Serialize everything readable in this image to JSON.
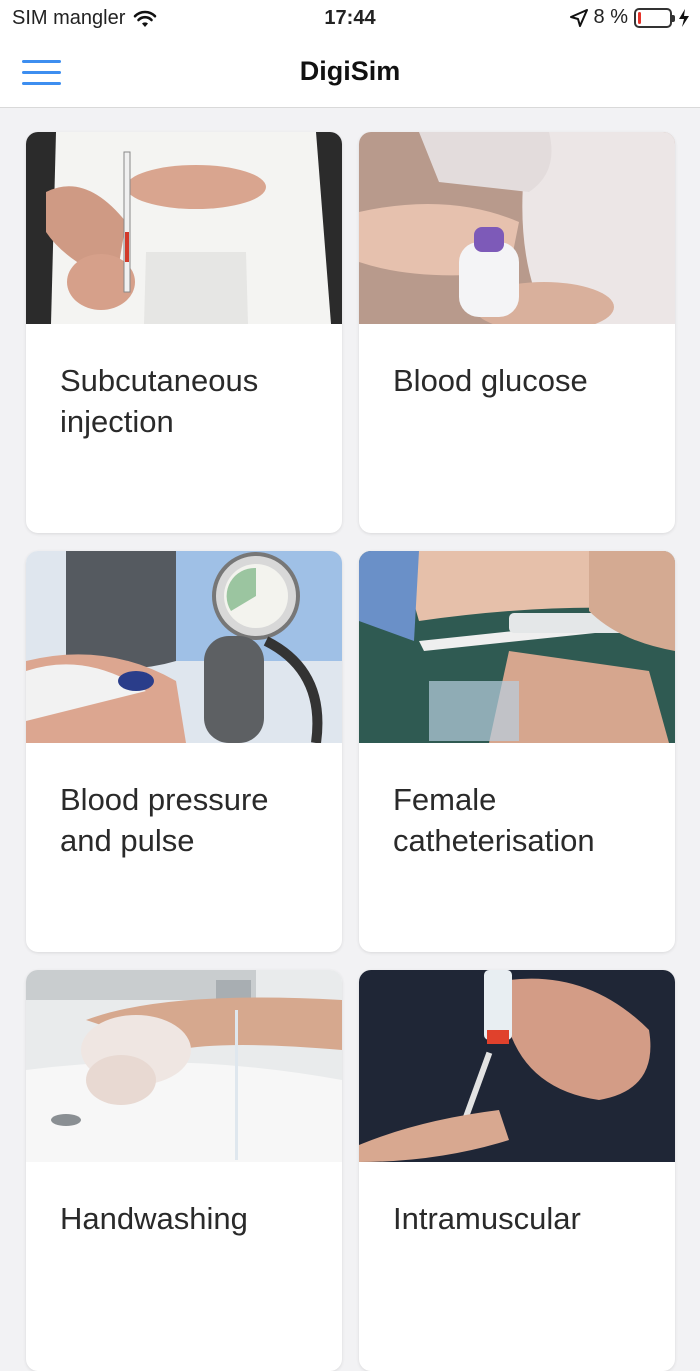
{
  "status_bar": {
    "carrier": "SIM mangler",
    "time": "17:44",
    "battery_percent": "8 %",
    "battery_level": 0.08,
    "icons": [
      "wifi-icon",
      "location-arrow-icon",
      "battery-icon",
      "charging-bolt-icon"
    ]
  },
  "nav": {
    "title": "DigiSim",
    "menu_icon": "hamburger-menu-icon",
    "accent_color": "#3d8ef0"
  },
  "cards": [
    {
      "title": "Subcutaneous injection",
      "image": "subcutaneous-injection-photo"
    },
    {
      "title": "Blood glucose",
      "image": "blood-glucose-photo"
    },
    {
      "title": "Blood pressure and pulse",
      "image": "blood-pressure-photo"
    },
    {
      "title": "Female catheterisation",
      "image": "female-catheterisation-photo"
    },
    {
      "title": "Handwashing",
      "image": "handwashing-photo"
    },
    {
      "title": "Intramuscular",
      "image": "intramuscular-injection-photo"
    }
  ]
}
